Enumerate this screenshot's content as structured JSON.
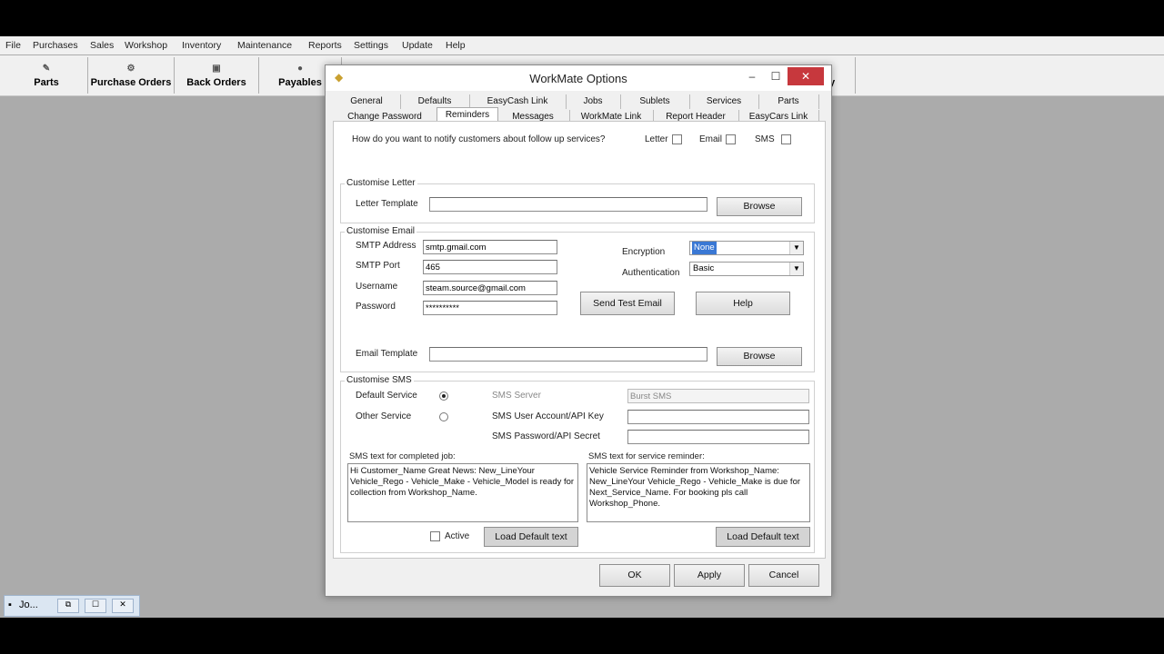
{
  "menu": [
    "File",
    "Purchases",
    "Sales",
    "Workshop",
    "Inventory",
    "Maintenance",
    "Reports",
    "Settings",
    "Update",
    "Help"
  ],
  "toolbar": {
    "parts": "Parts",
    "purchase_orders": "Purchase Orders",
    "back_orders": "Back Orders",
    "payables": "Payables",
    "partial_right": "y"
  },
  "minimized": {
    "label": "Jo..."
  },
  "dialog": {
    "title": "WorkMate Options",
    "tabs_row1": [
      "General",
      "Defaults",
      "EasyCash Link",
      "Jobs",
      "Sublets",
      "Services",
      "Parts"
    ],
    "tabs_row2": [
      "Change Password",
      "Reminders",
      "Messages",
      "WorkMate Link",
      "Report Header",
      "EasyCars Link"
    ],
    "active_tab": "Reminders",
    "notify_question": "How do you want to notify customers about follow up services?",
    "notify_letter": "Letter",
    "notify_email": "Email",
    "notify_sms": "SMS",
    "letter_group": "Customise Letter",
    "letter_template_label": "Letter Template",
    "letter_template_value": "",
    "browse_label": "Browse",
    "email_group": "Customise Email",
    "smtp_address_label": "SMTP Address",
    "smtp_address_value": "smtp.gmail.com",
    "smtp_port_label": "SMTP Port",
    "smtp_port_value": "465",
    "username_label": "Username",
    "username_value": "steam.source@gmail.com",
    "password_label": "Password",
    "password_value": "**********",
    "encryption_label": "Encryption",
    "encryption_value": "None",
    "authentication_label": "Authentication",
    "authentication_value": "Basic",
    "send_test_label": "Send Test Email",
    "help_label": "Help",
    "email_template_label": "Email Template",
    "email_template_value": "",
    "sms_group": "Customise SMS",
    "default_service_label": "Default Service",
    "other_service_label": "Other Service",
    "sms_server_label": "SMS Server",
    "sms_server_value": "Burst SMS",
    "sms_account_label": "SMS User Account/API Key",
    "sms_password_label": "SMS Password/API Secret",
    "sms_completed_label": "SMS text for completed job:",
    "sms_completed_text": "Hi Customer_Name Great News: New_LineYour Vehicle_Rego - Vehicle_Make - Vehicle_Model is ready for collection from Workshop_Name.",
    "sms_reminder_label": "SMS text for service reminder:",
    "sms_reminder_text": "Vehicle Service Reminder from Workshop_Name: New_LineYour Vehicle_Rego - Vehicle_Make is due for Next_Service_Name. For booking pls call Workshop_Phone.",
    "active_label": "Active",
    "load_default_label": "Load Default text",
    "ok_label": "OK",
    "apply_label": "Apply",
    "cancel_label": "Cancel",
    "close_glyph": "✕",
    "minimize_glyph": "–",
    "maximize_glyph": "☐"
  }
}
